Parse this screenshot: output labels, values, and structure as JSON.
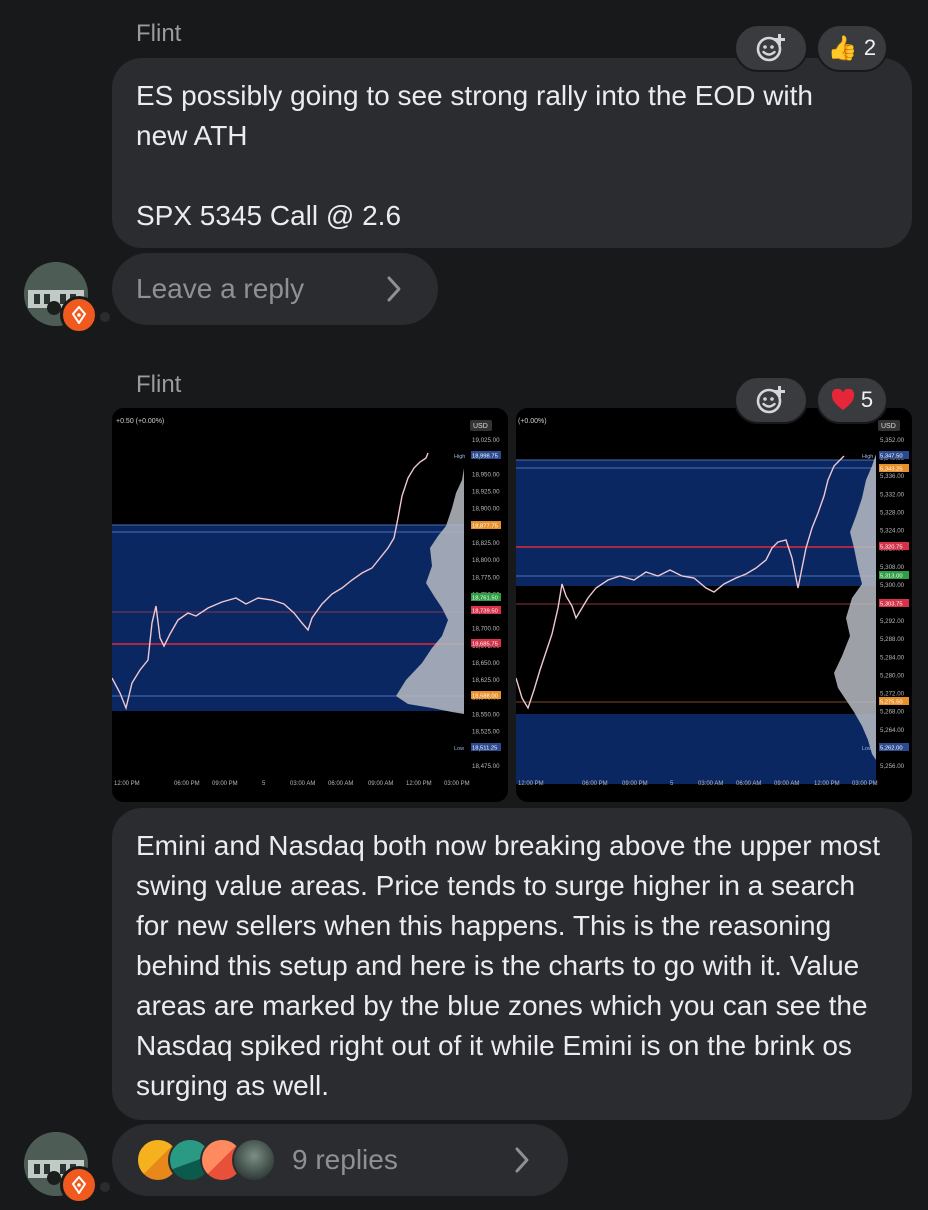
{
  "messages": [
    {
      "author": "Flint",
      "text": "ES possibly going to see strong rally into the EOD with\nnew ATH\n\nSPX 5345 Call @ 2.6",
      "reaction": {
        "emoji": "👍",
        "count": "2"
      },
      "reply_prompt": "Leave a reply"
    },
    {
      "author": "Flint",
      "text": "Emini and Nasdaq both now breaking above the upper most swing value areas. Price tends to surge higher in a search for new sellers when this happens. This is the reasoning behind this setup and here is the charts to go with it. Value areas are marked by the blue zones which you can see the Nasdaq spiked right out of it while Emini is on the brink os surging as well.",
      "reaction": {
        "emoji": "❤️",
        "count": "5"
      },
      "replies_label": "9 replies"
    }
  ],
  "icons": {
    "add_reaction": "add-reaction-icon",
    "chevron": "chevron-right-icon",
    "badge": "pen-nib-icon"
  },
  "charts": [
    {
      "header": "+0.50 (+0.00%)",
      "currency": "USD",
      "y_ticks": [
        "19,025.00",
        "18,975.00",
        "18,950.00",
        "18,925.00",
        "18,900.00",
        "18,850.00",
        "18,825.00",
        "18,800.00",
        "18,775.00",
        "18,750.00",
        "18,725.00",
        "18,700.00",
        "18,675.00",
        "18,650.00",
        "18,625.00",
        "18,575.00",
        "18,550.00",
        "18,525.00",
        "18,500.00",
        "18,475.00"
      ],
      "tags": [
        {
          "label": "High",
          "value": "18,998.75",
          "color": "#2b4a8f"
        },
        {
          "value": "18,877.75",
          "color": "#e8902a"
        },
        {
          "value": "18,761.50",
          "color": "#2f9e44"
        },
        {
          "value": "18,739.50",
          "color": "#d6334a"
        },
        {
          "value": "18,685.75",
          "color": "#d6334a"
        },
        {
          "value": "18,588.00",
          "color": "#e8902a"
        },
        {
          "label": "Low",
          "value": "18,511.25",
          "color": "#2b4a8f"
        }
      ],
      "x_ticks": [
        "12:00 PM",
        "06:00 PM",
        "09:00 PM",
        "5",
        "03:00 AM",
        "06:00 AM",
        "09:00 AM",
        "12:00 PM",
        "03:00 PM"
      ]
    },
    {
      "header": "(+0.00%)",
      "currency": "USD",
      "y_ticks": [
        "5,352.00",
        "5,340.00",
        "5,336.00",
        "5,332.00",
        "5,328.00",
        "5,324.00",
        "5,316.00",
        "5,308.00",
        "5,300.00",
        "5,296.00",
        "5,292.00",
        "5,288.00",
        "5,284.00",
        "5,280.00",
        "5,272.00",
        "5,268.00",
        "5,264.00",
        "5,260.00",
        "5,256.00"
      ],
      "tags": [
        {
          "label": "High",
          "value": "5,347.50",
          "color": "#2b4a8f"
        },
        {
          "value": "5,343.25",
          "color": "#e8902a"
        },
        {
          "value": "5,320.75",
          "color": "#d6334a"
        },
        {
          "value": "5,313.00",
          "color": "#2f9e44"
        },
        {
          "value": "5,303.75",
          "color": "#d6334a"
        },
        {
          "value": "5,275.50",
          "color": "#e8902a"
        },
        {
          "label": "Low",
          "value": "5,262.00",
          "color": "#2b4a8f"
        }
      ],
      "x_ticks": [
        "12:00 PM",
        "06:00 PM",
        "09:00 PM",
        "5",
        "03:00 AM",
        "06:00 AM",
        "09:00 AM",
        "12:00 PM",
        "03:00 PM"
      ]
    }
  ]
}
